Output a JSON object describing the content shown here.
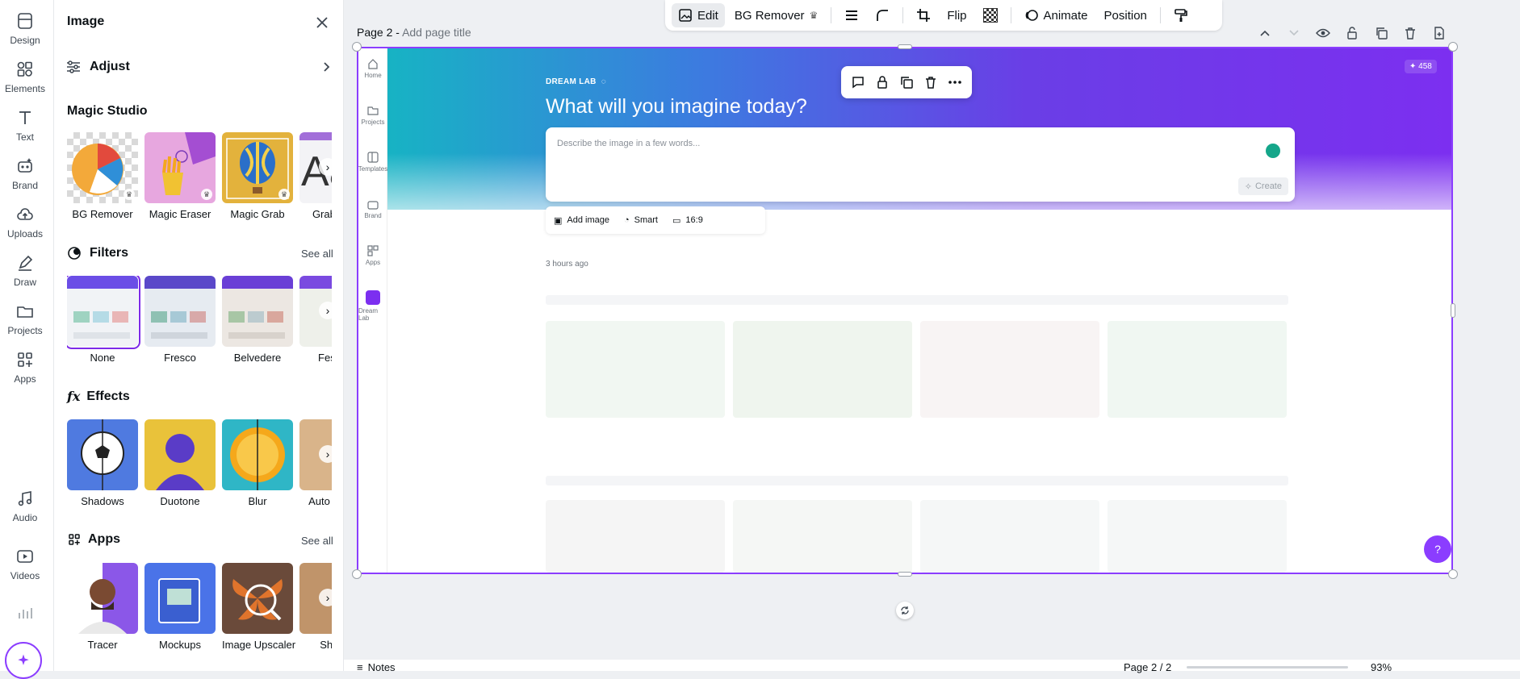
{
  "rail": {
    "items": [
      {
        "label": "Design",
        "icon": "design-icon"
      },
      {
        "label": "Elements",
        "icon": "elements-icon"
      },
      {
        "label": "Text",
        "icon": "text-icon"
      },
      {
        "label": "Brand",
        "icon": "brand-icon"
      },
      {
        "label": "Uploads",
        "icon": "uploads-icon"
      },
      {
        "label": "Draw",
        "icon": "draw-icon"
      },
      {
        "label": "Projects",
        "icon": "projects-icon"
      },
      {
        "label": "Apps",
        "icon": "apps-icon"
      },
      {
        "label": "Audio",
        "icon": "audio-icon"
      },
      {
        "label": "Videos",
        "icon": "videos-icon"
      }
    ]
  },
  "panel": {
    "title": "Image",
    "adjust_label": "Adjust",
    "magic_studio": {
      "title": "Magic Studio",
      "items": [
        "BG Remover",
        "Magic Eraser",
        "Magic Grab",
        "Grab Text"
      ]
    },
    "filters": {
      "title": "Filters",
      "see_all": "See all",
      "items": [
        "None",
        "Fresco",
        "Belvedere",
        "Festive"
      ],
      "selected": "None"
    },
    "effects": {
      "title": "Effects",
      "items": [
        "Shadows",
        "Duotone",
        "Blur",
        "Auto Focus"
      ]
    },
    "apps": {
      "title": "Apps",
      "see_all": "See all",
      "items": [
        "Tracer",
        "Mockups",
        "Image Upscaler",
        "Shape"
      ]
    }
  },
  "toolbar": {
    "edit": "Edit",
    "bg_remover": "BG Remover",
    "flip": "Flip",
    "animate": "Animate",
    "position": "Position"
  },
  "page": {
    "label": "Page 2 -",
    "title_placeholder": "Add page title"
  },
  "canvas_app": {
    "side": [
      "Home",
      "Projects",
      "Templates",
      "Brand",
      "Apps",
      "Dream Lab"
    ],
    "brand_name": "DREAM LAB",
    "headline": "What will you imagine today?",
    "credits": "458",
    "prompt_placeholder": "Describe the image in a few words...",
    "create_label": "Create",
    "options": [
      "Add image",
      "Smart",
      "16:9"
    ],
    "timestamp": "3 hours ago"
  },
  "bottom": {
    "notes": "Notes",
    "page_count": "Page 2 / 2",
    "zoom": "93%"
  },
  "colors": {
    "accent": "#8b3dff",
    "selection": "#7d2ae8"
  }
}
